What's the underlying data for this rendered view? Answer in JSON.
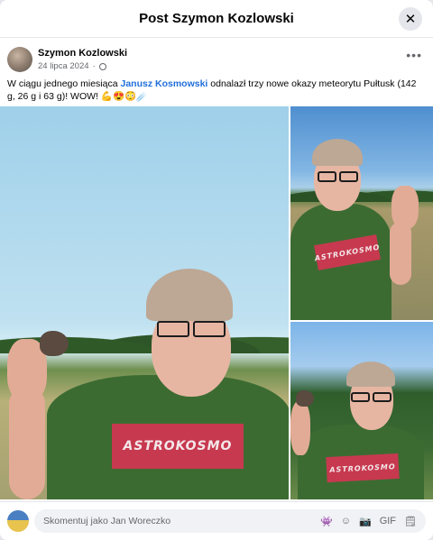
{
  "header": {
    "title": "Post Szymon Kozlowski",
    "close_icon": "✕"
  },
  "post": {
    "author": "Szymon Kozlowski",
    "date": "24 lipca 2024",
    "separator": "·",
    "more_icon": "•••",
    "text_before": "W ciągu jednego miesiąca ",
    "mention": "Janusz Kosmowski",
    "text_after": " odnalazł trzy nowe okazy meteorytu Pułtusk (142 g, 26 g i 63 g)! WOW! 💪😍😳☄️"
  },
  "photos": {
    "shirt_text": "ASTROKOSMO"
  },
  "comment": {
    "placeholder": "Skomentuj jako Jan Woreczko",
    "icons": [
      "👾",
      "☺",
      "📷",
      "GIF",
      "🗒"
    ]
  }
}
